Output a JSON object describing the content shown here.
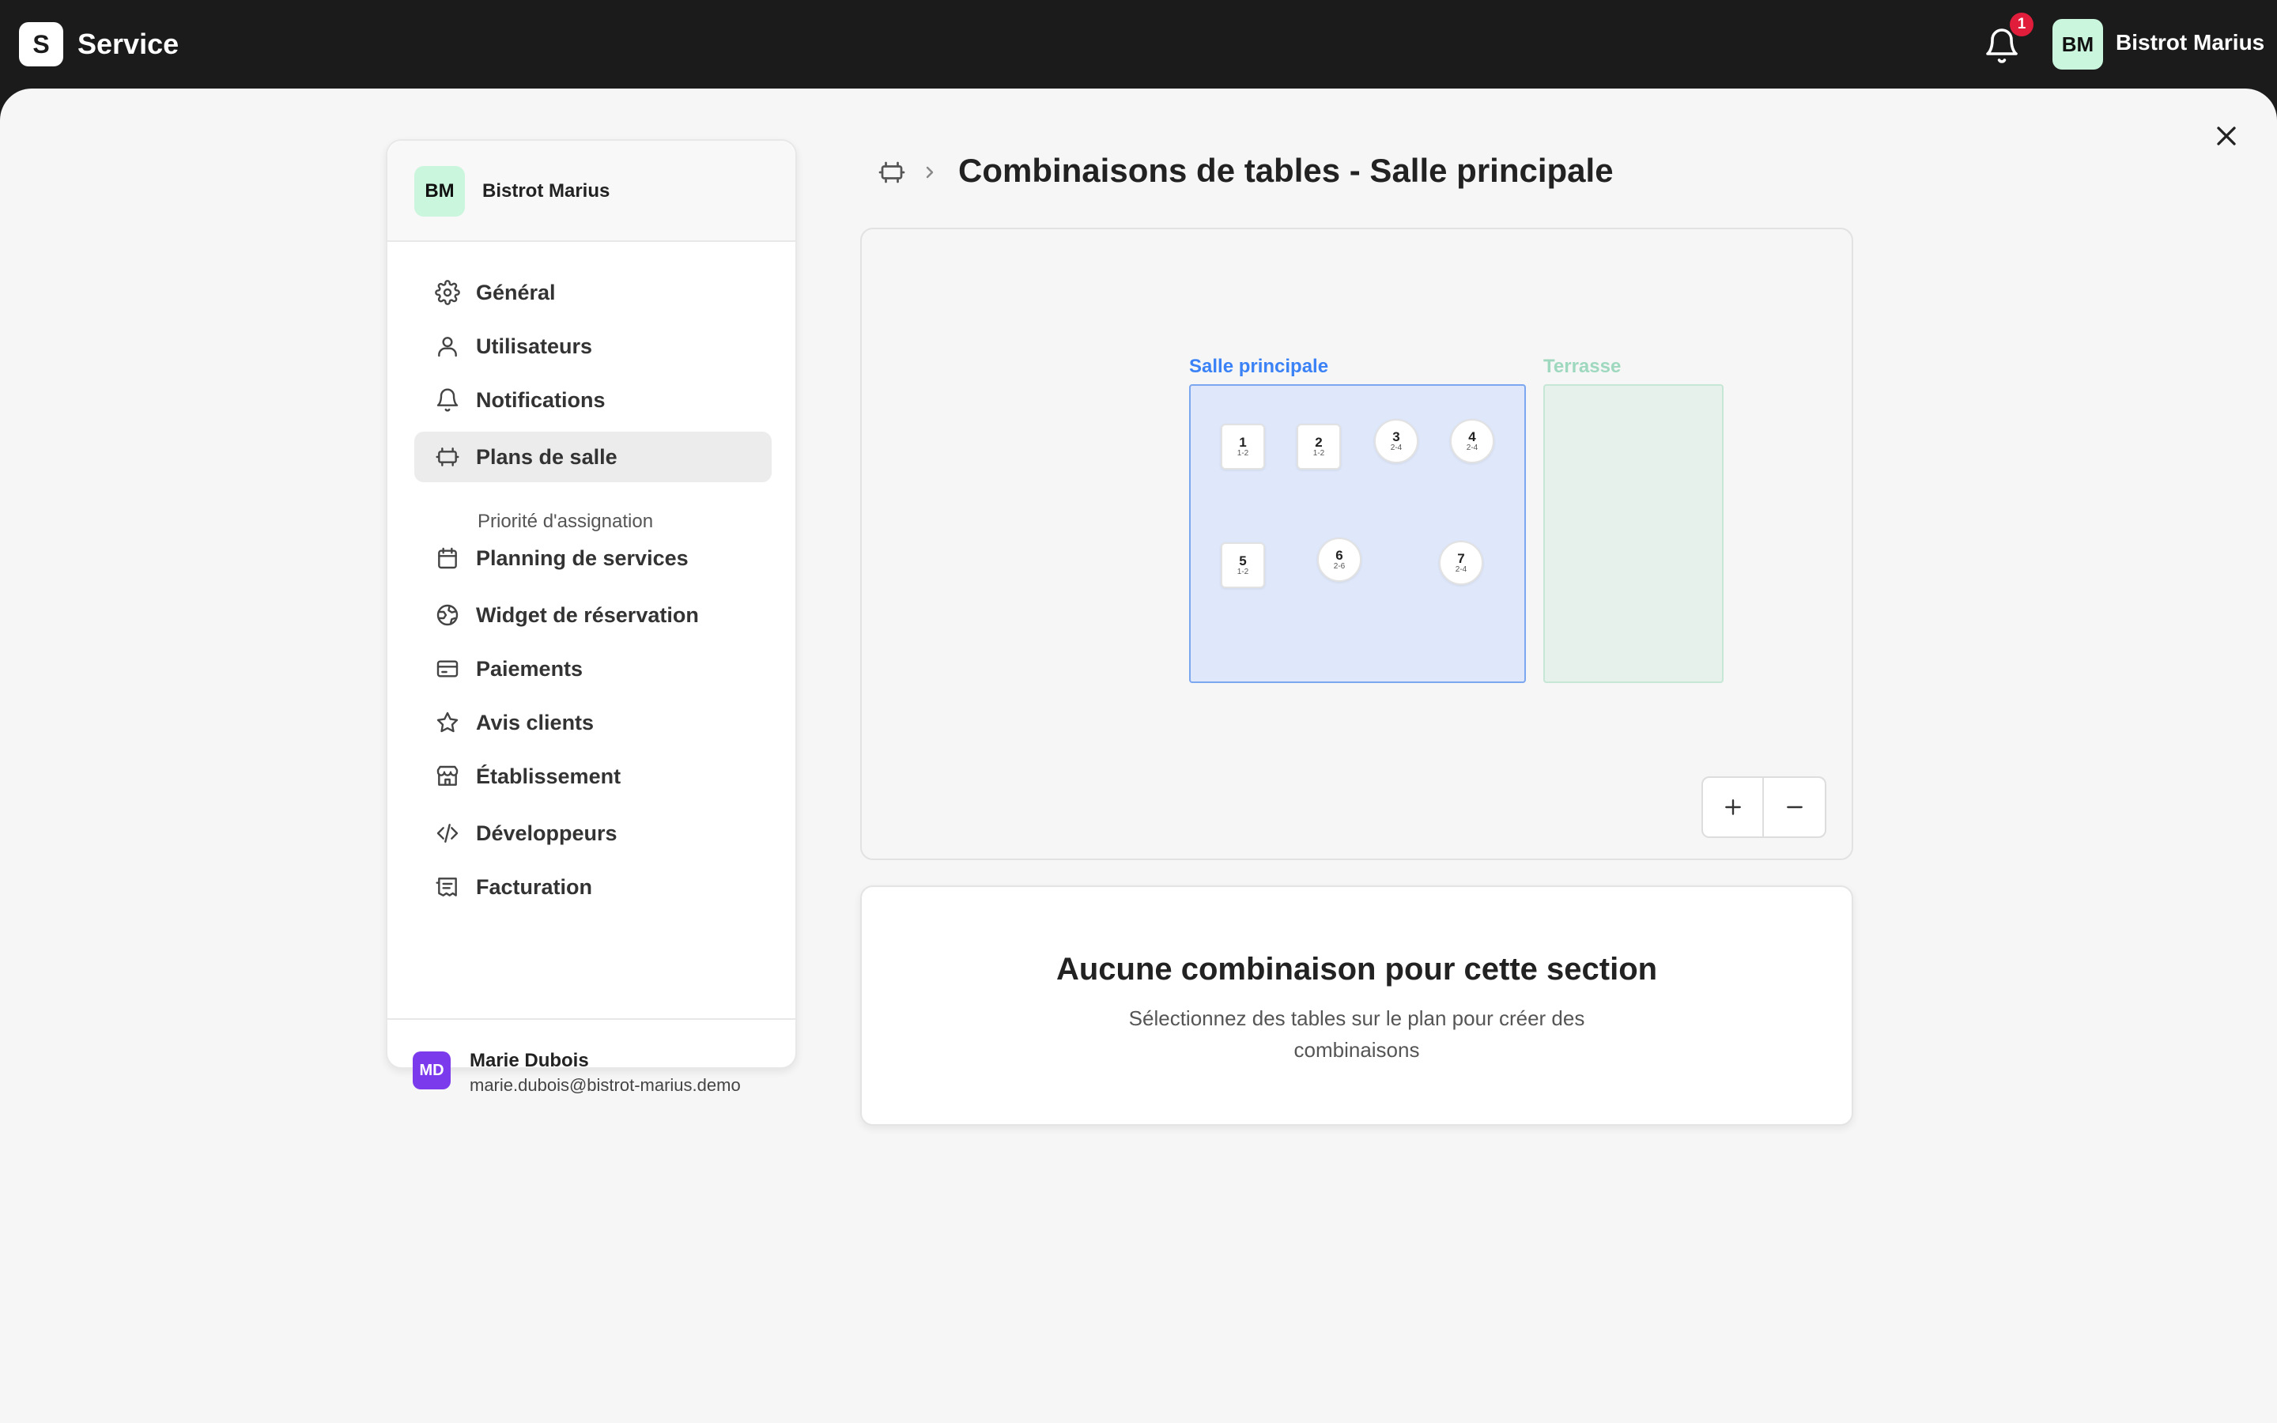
{
  "app": {
    "logo_letter": "S",
    "name": "Service"
  },
  "header": {
    "notification_count": "1",
    "user_initials": "BM",
    "user_name": "Bistrot Marius"
  },
  "sidebar": {
    "org_initials": "BM",
    "org_name": "Bistrot Marius",
    "items": [
      {
        "label": "Général",
        "icon": "gear-icon"
      },
      {
        "label": "Utilisateurs",
        "icon": "user-icon"
      },
      {
        "label": "Notifications",
        "icon": "bell-icon"
      },
      {
        "label": "Plans de salle",
        "icon": "floorplan-icon",
        "active": true
      },
      {
        "label": "Planning de services",
        "icon": "calendar-icon"
      },
      {
        "label": "Widget de réservation",
        "icon": "globe-icon"
      },
      {
        "label": "Paiements",
        "icon": "credit-card-icon"
      },
      {
        "label": "Avis clients",
        "icon": "star-icon"
      },
      {
        "label": "Établissement",
        "icon": "store-icon"
      },
      {
        "label": "Développeurs",
        "icon": "code-icon"
      },
      {
        "label": "Facturation",
        "icon": "receipt-icon"
      }
    ],
    "sub_item": "Priorité d'assignation",
    "footer": {
      "initials": "MD",
      "name": "Marie Dubois",
      "email": "marie.dubois@bistrot-marius.demo"
    }
  },
  "page": {
    "title": "Combinaisons de tables - Salle principale"
  },
  "floor_plan": {
    "sections": [
      {
        "name": "Salle principale",
        "color": "#3b82f6",
        "selected": true
      },
      {
        "name": "Terrasse",
        "color": "#9ed8bf",
        "selected": false
      }
    ],
    "tables": [
      {
        "number": "1",
        "capacity": "1-2",
        "shape": "square"
      },
      {
        "number": "2",
        "capacity": "1-2",
        "shape": "square"
      },
      {
        "number": "3",
        "capacity": "2-4",
        "shape": "round"
      },
      {
        "number": "4",
        "capacity": "2-4",
        "shape": "round"
      },
      {
        "number": "5",
        "capacity": "1-2",
        "shape": "square"
      },
      {
        "number": "6",
        "capacity": "2-6",
        "shape": "round"
      },
      {
        "number": "7",
        "capacity": "2-4",
        "shape": "round"
      }
    ],
    "zoom_in_label": "+",
    "zoom_out_label": "−"
  },
  "empty_state": {
    "title": "Aucune combinaison pour cette section",
    "text": "Sélectionnez des tables sur le plan pour créer des combinaisons"
  }
}
